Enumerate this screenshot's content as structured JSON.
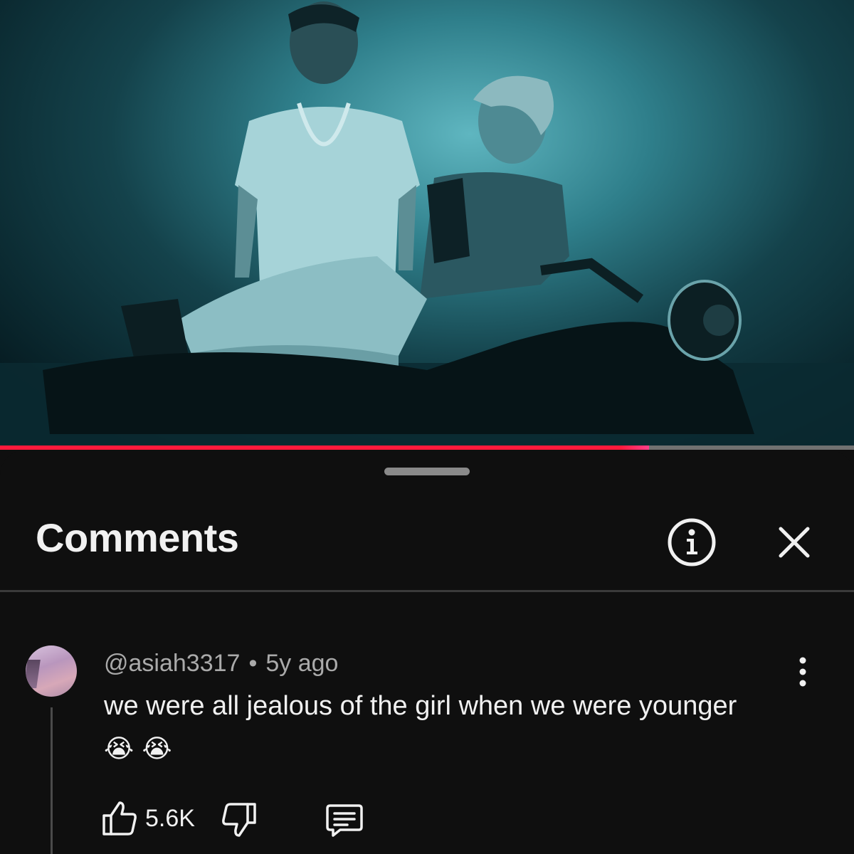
{
  "video": {
    "description_icon": "video-frame",
    "progress_fraction": 0.76,
    "progress_color": "#ff1a3c"
  },
  "sheet": {
    "title": "Comments",
    "info_icon": "info-icon",
    "close_icon": "close-icon"
  },
  "comment": {
    "author": "@asiah3317",
    "separator": "•",
    "time": "5y ago",
    "text": "we were all jealous of the girl when we were younger",
    "emojis": "😭 😭",
    "likes": "5.6K",
    "more_icon": "more-vertical-icon",
    "like_icon": "thumbs-up-icon",
    "dislike_icon": "thumbs-down-icon",
    "reply_icon": "reply-comment-icon"
  }
}
